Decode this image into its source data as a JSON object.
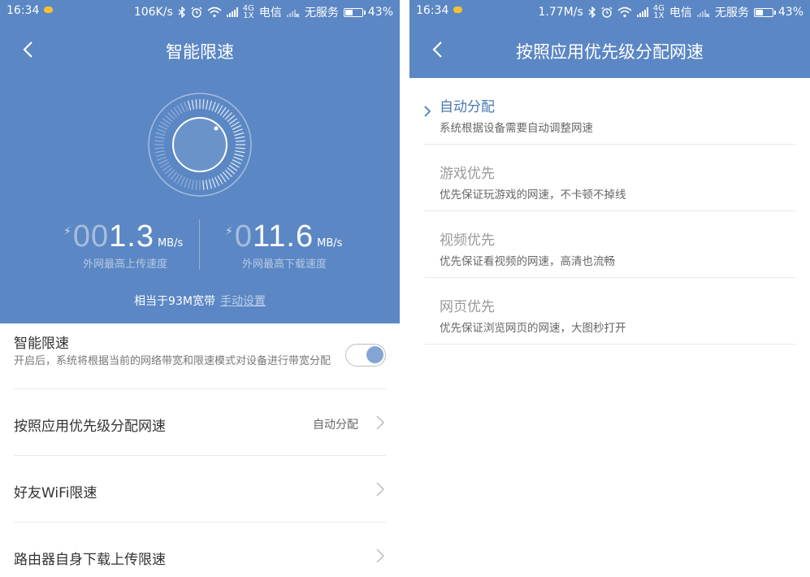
{
  "left": {
    "status": {
      "time": "16:34",
      "speed": "106K/s",
      "net_top": "4G",
      "net_bottom": "1X",
      "carrier": "电信",
      "no_service": "无服务",
      "battery": "43%",
      "battery_level": 0.43
    },
    "title": "智能限速",
    "upload": {
      "dim": "00",
      "value": "1.3",
      "unit": "MB/s",
      "label": "外网最高上传速度"
    },
    "download": {
      "dim": "0",
      "value": "11.6",
      "unit": "MB/s",
      "label": "外网最高下载速度"
    },
    "equiv_text": "相当于93M宽带",
    "equiv_link": "手动设置",
    "smart": {
      "title": "智能限速",
      "desc": "开启后，系统将根据当前的网络带宽和限速模式对设备进行带宽分配",
      "enabled": true
    },
    "menu": [
      {
        "label": "按照应用优先级分配网速",
        "value": "自动分配"
      },
      {
        "label": "好友WiFi限速",
        "value": ""
      },
      {
        "label": "路由器自身下载上传限速",
        "value": ""
      }
    ]
  },
  "right": {
    "status": {
      "time": "16:34",
      "speed": "1.77M/s",
      "net_top": "4G",
      "net_bottom": "1X",
      "carrier": "电信",
      "no_service": "无服务",
      "battery": "43%",
      "battery_level": 0.43
    },
    "title": "按照应用优先级分配网速",
    "options": [
      {
        "name": "自动分配",
        "desc": "系统根据设备需要自动调整网速",
        "selected": true
      },
      {
        "name": "游戏优先",
        "desc": "优先保证玩游戏的网速，不卡顿不掉线",
        "selected": false
      },
      {
        "name": "视频优先",
        "desc": "优先保证看视频的网速，高清也流畅",
        "selected": false
      },
      {
        "name": "网页优先",
        "desc": "优先保证浏览网页的网速，大图秒打开",
        "selected": false
      }
    ]
  },
  "colors": {
    "primary": "#5b87c4",
    "selected_text": "#4a78b5"
  }
}
